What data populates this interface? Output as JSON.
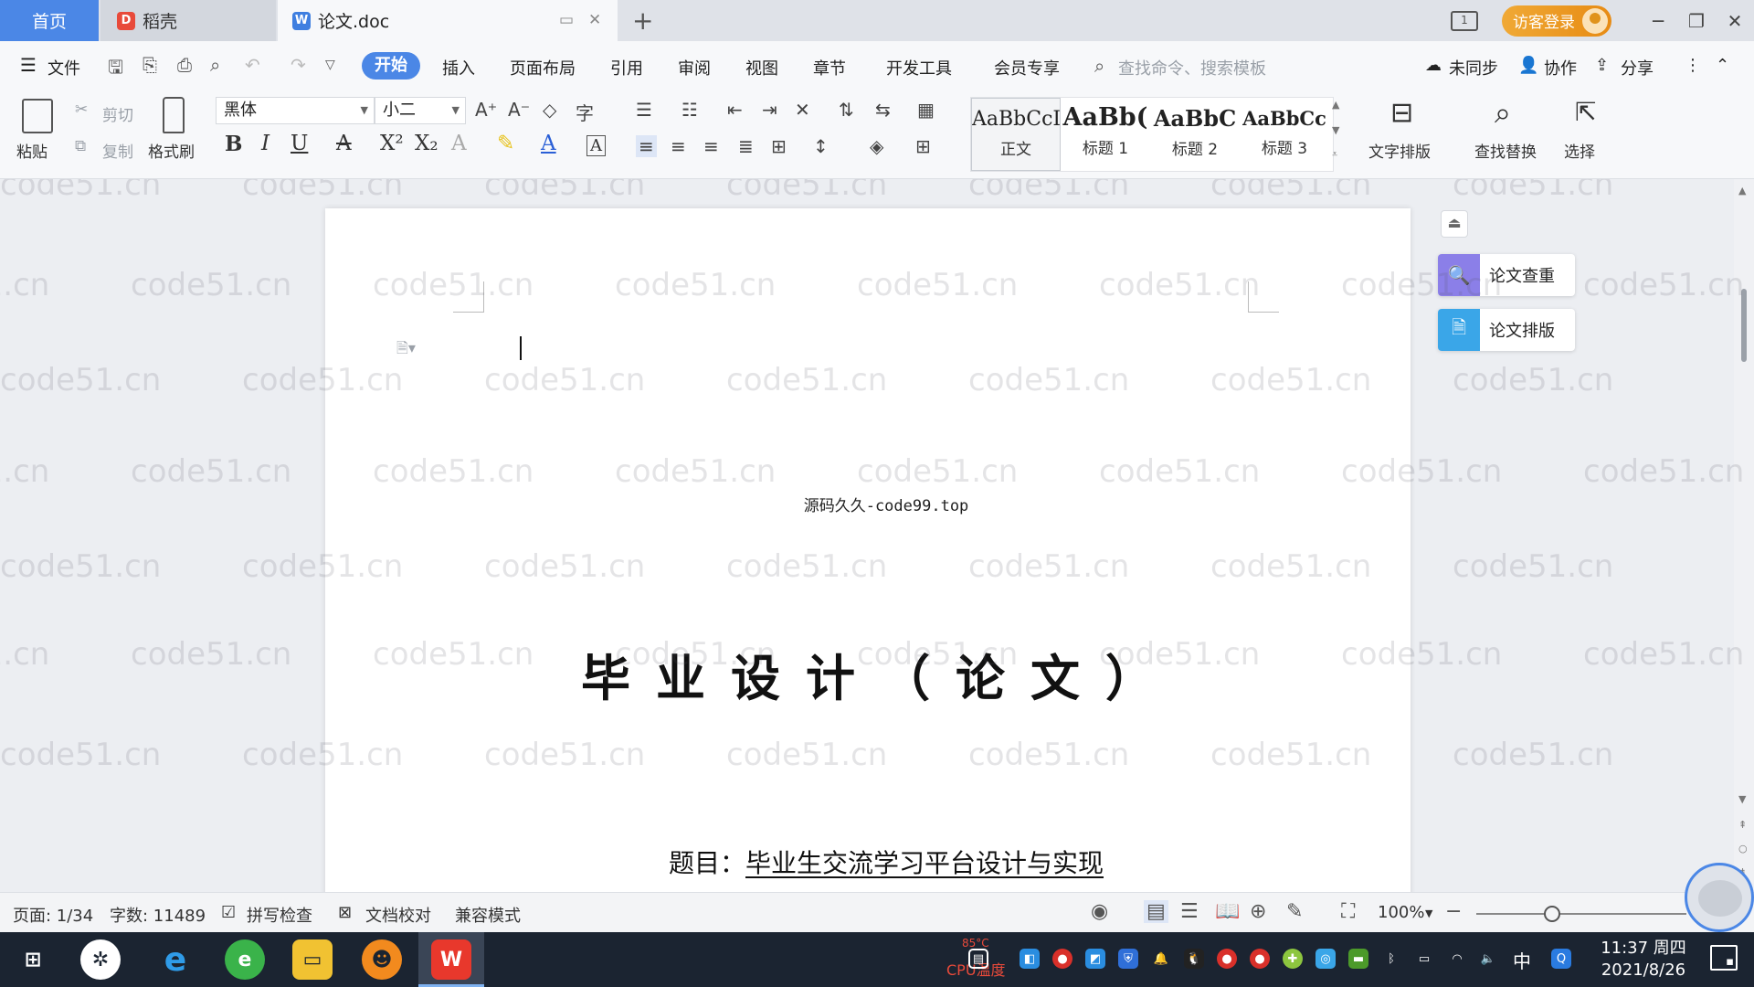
{
  "tabs": {
    "home": "首页",
    "daoke": "稻壳",
    "doc": "论文.doc",
    "add": "+"
  },
  "titlebar": {
    "layout_badge": "1",
    "login": "访客登录",
    "minimize": "─",
    "restore": "❐",
    "close": "✕"
  },
  "menu": {
    "file": "文件",
    "items": [
      "开始",
      "插入",
      "页面布局",
      "引用",
      "审阅",
      "视图",
      "章节",
      "开发工具",
      "会员专享"
    ],
    "search_placeholder": "查找命令、搜索模板",
    "unsynced": "未同步",
    "collaborate": "协作",
    "share": "分享"
  },
  "ribbon": {
    "paste": "粘贴",
    "cut": "剪切",
    "copy": "复制",
    "format_painter": "格式刷",
    "font_name": "黑体",
    "font_size": "小二",
    "styles": [
      {
        "sample": "AaBbCcI",
        "name": "正文"
      },
      {
        "sample": "AaBb(",
        "name": "标题 1"
      },
      {
        "sample": "AaBbC",
        "name": "标题 2"
      },
      {
        "sample": "AaBbCc",
        "name": "标题 3"
      }
    ],
    "text_layout": "文字排版",
    "find_replace": "查找替换",
    "select": "选择"
  },
  "document": {
    "source_line": "源码久久-code99.top",
    "title": "毕业设计（论文）",
    "subject_label": "题目：",
    "subject_value": "毕业生交流学习平台设计与实现"
  },
  "side_panel": {
    "check": "论文查重",
    "layout": "论文排版"
  },
  "watermark": "code51.cn",
  "statusbar": {
    "page": "页面: 1/34",
    "words": "字数: 11489",
    "spell_check": "拼写检查",
    "doc_proof": "文档校对",
    "compat_mode": "兼容模式",
    "zoom": "100%",
    "zoom_fraction": 0.36
  },
  "taskbar": {
    "time": "11:37 周四",
    "date": "2021/8/26",
    "ime": "中",
    "cpu_label": "CPU温度",
    "cpu_temp": "85°C"
  },
  "colors": {
    "accent": "#4b87e6",
    "login_orange": "#e78b14",
    "taskbar": "#1b2431"
  }
}
